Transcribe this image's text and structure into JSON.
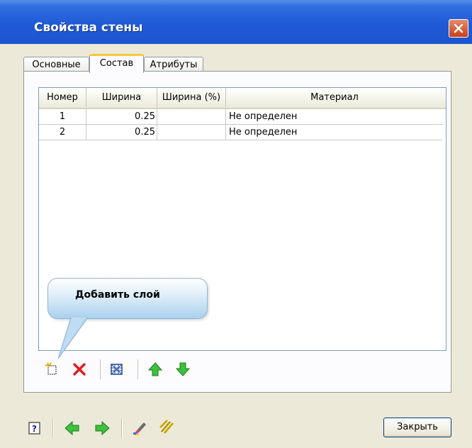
{
  "window": {
    "title": "Свойства стены",
    "close_icon": "close-icon",
    "accent_color": "#2f6fe0"
  },
  "tabs": [
    {
      "label": "Основные",
      "active": false
    },
    {
      "label": "Состав",
      "active": true
    },
    {
      "label": "Атрибуты",
      "active": false
    }
  ],
  "table": {
    "columns": [
      "Номер",
      "Ширина",
      "Ширина (%)",
      "Материал"
    ],
    "rows": [
      {
        "num": "1",
        "width": "0.25",
        "width_pct": "",
        "material": "Не определен"
      },
      {
        "num": "2",
        "width": "0.25",
        "width_pct": "",
        "material": "Не определен"
      }
    ]
  },
  "tooltip": {
    "text": "Добавить слой"
  },
  "layer_toolbar": [
    "add-layer-icon",
    "delete-layer-icon",
    "layer-grid-icon",
    "move-up-icon",
    "move-down-icon"
  ],
  "bottom_toolbar": [
    "help-icon",
    "back-arrow-icon",
    "forward-arrow-icon",
    "paint-brush-icon",
    "pattern-tool-icon"
  ],
  "buttons": {
    "close_label": "Закрыть"
  }
}
